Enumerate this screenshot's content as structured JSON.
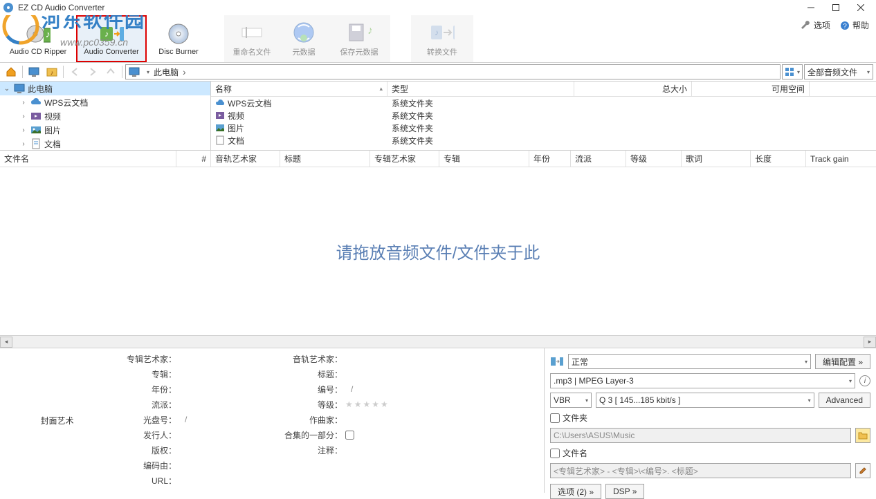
{
  "window": {
    "title": "EZ CD Audio Converter",
    "options_link": "选项",
    "help_link": "帮助"
  },
  "watermark": {
    "brand": "河东软件园",
    "url": "www.pc0359.cn"
  },
  "toolbar": {
    "ripper": "Audio CD Ripper",
    "converter": "Audio Converter",
    "disc_burner": "Disc Burner",
    "rename": "重命名文件",
    "metadata": "元数据",
    "save_meta": "保存元数据",
    "convert": "转换文件"
  },
  "nav": {
    "breadcrumb_root": "此电脑",
    "filter": "全部音频文件"
  },
  "tree": {
    "root": "此电脑",
    "items": [
      "WPS云文档",
      "视频",
      "图片",
      "文档"
    ]
  },
  "file_cols": {
    "name": "名称",
    "type": "类型",
    "size": "总大小",
    "free": "可用空间"
  },
  "files": [
    {
      "name": "WPS云文档",
      "type": "系统文件夹"
    },
    {
      "name": "视频",
      "type": "系统文件夹"
    },
    {
      "name": "图片",
      "type": "系统文件夹"
    },
    {
      "name": "文档",
      "type": "系统文件夹"
    }
  ],
  "track_cols": {
    "filename": "文件名",
    "num": "#",
    "track_artist": "音轨艺术家",
    "title": "标题",
    "album_artist": "专辑艺术家",
    "album": "专辑",
    "year": "年份",
    "genre": "流派",
    "rating": "等级",
    "lyrics": "歌词",
    "length": "长度",
    "track_gain": "Track gain"
  },
  "drop_hint": "请拖放音频文件/文件夹于此",
  "meta": {
    "cover_label": "封面艺术",
    "album_artist_lbl": "专辑艺术家：",
    "album_lbl": "专辑：",
    "year_lbl": "年份：",
    "genre_lbl": "流派：",
    "disc_lbl": "光盘号：",
    "publisher_lbl": "发行人：",
    "copyright_lbl": "版权：",
    "encoded_lbl": "编码由：",
    "url_lbl": "URL：",
    "track_artist_lbl": "音轨艺术家：",
    "title_lbl": "标题：",
    "track_no_lbl": "编号：",
    "rating_lbl": "等级：",
    "composer_lbl": "作曲家：",
    "compilation_lbl": "合集的一部分：",
    "comment_lbl": "注释：",
    "slash": "/"
  },
  "output": {
    "profile": "正常",
    "edit_profile": "编辑配置 »",
    "format": ".mp3 | MPEG Layer-3",
    "mode": "VBR",
    "quality": "Q 3  [ 145...185 kbit/s ]",
    "advanced": "Advanced",
    "folder_chk": "文件夹",
    "folder_path": "C:\\Users\\ASUS\\Music",
    "filename_chk": "文件名",
    "filename_pattern": "<专辑艺术家> - <专辑>\\<编号>. <标题>",
    "options_btn": "选项 (2) »",
    "dsp_btn": "DSP »"
  }
}
